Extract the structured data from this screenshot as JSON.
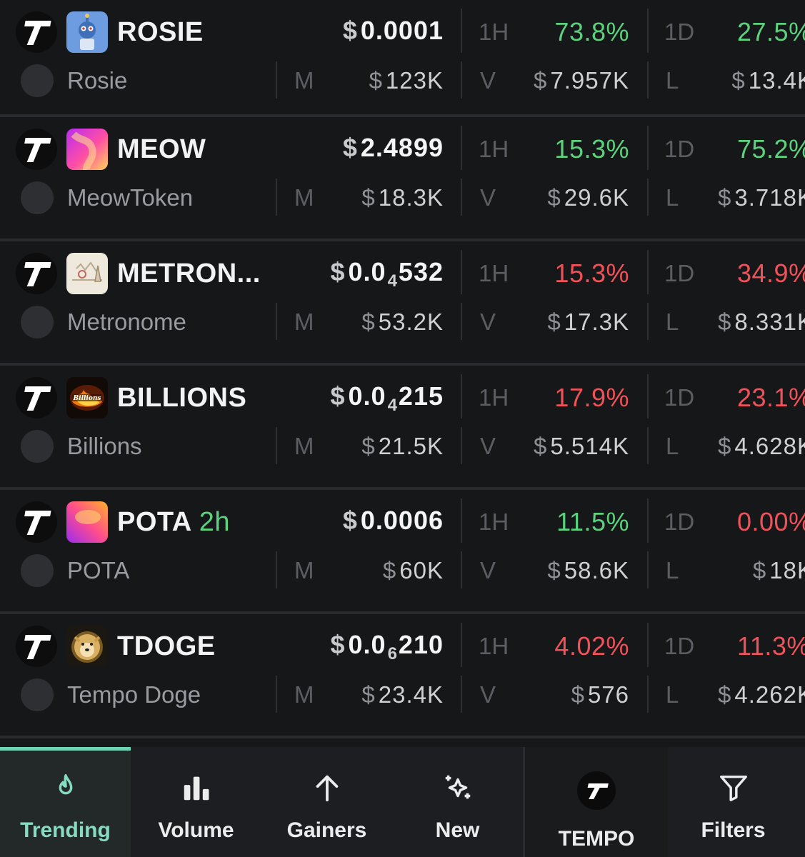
{
  "tokens": [
    {
      "symbol": "ROSIE",
      "age": "",
      "name": "Rosie",
      "price": "0.0001",
      "price_sub": "",
      "price_tail": "",
      "h1": "73.8%",
      "h1_dir": "up",
      "d1": "27.5%",
      "d1_dir": "up",
      "mcap": "123K",
      "vol": "7.957K",
      "liq": "13.4K",
      "logo": "robot"
    },
    {
      "symbol": "MEOW",
      "age": "",
      "name": "MeowToken",
      "price": "2.4899",
      "price_sub": "",
      "price_tail": "",
      "h1": "15.3%",
      "h1_dir": "up",
      "d1": "75.2%",
      "d1_dir": "up",
      "mcap": "18.3K",
      "vol": "29.6K",
      "liq": "3.718K",
      "logo": "gradient-magenta"
    },
    {
      "symbol": "METRON...",
      "age": "",
      "name": "Metronome",
      "price": "0.0",
      "price_sub": "4",
      "price_tail": "532",
      "h1": "15.3%",
      "h1_dir": "down",
      "d1": "34.9%",
      "d1_dir": "down",
      "mcap": "53.2K",
      "vol": "17.3K",
      "liq": "8.331K",
      "logo": "sketch"
    },
    {
      "symbol": "BILLIONS",
      "age": "",
      "name": "Billions",
      "price": "0.0",
      "price_sub": "4",
      "price_tail": "215",
      "h1": "17.9%",
      "h1_dir": "down",
      "d1": "23.1%",
      "d1_dir": "down",
      "mcap": "21.5K",
      "vol": "5.514K",
      "liq": "4.628K",
      "logo": "billions-fire"
    },
    {
      "symbol": "POTA",
      "age": "2h",
      "name": "POTA",
      "price": "0.0006",
      "price_sub": "",
      "price_tail": "",
      "h1": "11.5%",
      "h1_dir": "up",
      "d1": "0.00%",
      "d1_dir": "down",
      "mcap": "60K",
      "vol": "58.6K",
      "liq": "18K",
      "logo": "gradient-orange"
    },
    {
      "symbol": "TDOGE",
      "age": "",
      "name": "Tempo Doge",
      "price": "0.0",
      "price_sub": "6",
      "price_tail": "210",
      "h1": "4.02%",
      "h1_dir": "down",
      "d1": "11.3%",
      "d1_dir": "down",
      "mcap": "23.4K",
      "vol": "576",
      "liq": "4.262K",
      "logo": "doge"
    }
  ],
  "labels": {
    "h1": "1H",
    "d1": "1D",
    "mcap": "M",
    "vol": "V",
    "liq": "L",
    "currency": "$"
  },
  "nav": {
    "tabs": [
      {
        "label": "Trending",
        "icon": "flame-icon",
        "active": true
      },
      {
        "label": "Volume",
        "icon": "bar-chart-icon",
        "active": false
      },
      {
        "label": "Gainers",
        "icon": "arrow-up-icon",
        "active": false
      },
      {
        "label": "New",
        "icon": "sparkle-icon",
        "active": false
      }
    ],
    "chain": "TEMPO",
    "filters": "Filters"
  },
  "colors": {
    "up": "#5dd27e",
    "down": "#f0525a",
    "accent": "#87dcc0",
    "background": "#161719"
  }
}
